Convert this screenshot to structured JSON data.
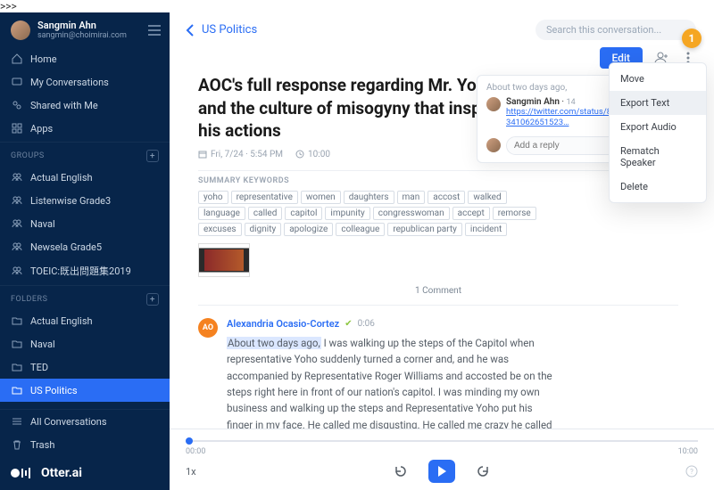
{
  "profile": {
    "name": "Sangmin Ahn",
    "email": "sangmin@choimirai.com"
  },
  "nav": {
    "home": "Home",
    "my_conv": "My Conversations",
    "shared": "Shared with Me",
    "apps": "Apps"
  },
  "sections": {
    "groups_label": "GROUPS",
    "folders_label": "FOLDERS"
  },
  "groups": [
    "Actual English",
    "Listenwise Grade3",
    "Naval",
    "Newsela Grade5",
    "TOEIC:既出問題集2019"
  ],
  "folders": [
    "Actual English",
    "Naval",
    "TED",
    "US Politics"
  ],
  "active_folder_index": 3,
  "bottom_nav": {
    "all": "All Conversations",
    "trash": "Trash"
  },
  "brand": "Otter.ai",
  "header": {
    "breadcrumb": "US Politics",
    "search_placeholder": "Search this conversation...",
    "edit": "Edit"
  },
  "doc": {
    "title": "AOC's full response regarding Mr. Yoho and the culture of misogyny that inspired his actions",
    "date": "Fri, 7/24 · 5:54 PM",
    "duration": "10:00",
    "summary_label": "SUMMARY KEYWORDS",
    "keywords": [
      "yoho",
      "representative",
      "women",
      "daughters",
      "man",
      "accost",
      "walked",
      "language",
      "called",
      "capitol",
      "impunity",
      "congresswoman",
      "accept",
      "remorse",
      "excuses",
      "dignity",
      "apologize",
      "colleague",
      "republican party",
      "incident"
    ],
    "comment_count": "1 Comment"
  },
  "transcript": {
    "speaker_initials": "AO",
    "speaker": "Alexandria Ocasio-Cortez",
    "timestamp": "0:06",
    "highlight": "About two days ago,",
    "text": " I was walking up the steps of the Capitol when representative Yoho suddenly turned a corner and, and he was accompanied by Representative Roger Williams and accosted be on the steps right here in front of our nation's capitol. I was minding my own business and walking up the steps and Representative Yoho put his finger in my face. He called me disgusting. He called me crazy he called me out of my mind. And he called me dangerous. And then he took a few more steps. And after I had recognized his after I had recognized his, his comments is rude. He"
  },
  "player": {
    "start": "00:00",
    "end": "10:00",
    "speed": "1x"
  },
  "popover": {
    "when": "About two days ago,",
    "user": "Sangmin Ahn",
    "date": "14",
    "link": "https://twitter.com/status/86341062651523…",
    "reply_placeholder": "Add a reply"
  },
  "menu": {
    "items": [
      "Move",
      "Export Text",
      "Export Audio",
      "Rematch Speaker",
      "Delete"
    ],
    "hover_index": 1
  },
  "annotation": "1"
}
